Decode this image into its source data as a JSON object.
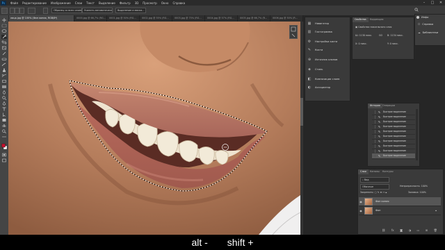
{
  "menubar": {
    "logo": "Ps",
    "items": [
      "Файл",
      "Редактирование",
      "Изображение",
      "Слои",
      "Текст",
      "Выделение",
      "Фильтр",
      "3D",
      "Просмотр",
      "Окно",
      "Справка"
    ],
    "window_controls": [
      "–",
      "□",
      "✕"
    ]
  },
  "options_bar": {
    "sample_all_layers": "Образец со всех слоев",
    "enhance_edge": "Усилить автоматически",
    "select_and_mask": "Выделение и маска..."
  },
  "document_tabs": {
    "active": "лицо.jpg @ 100% (Фон копия, RGB/8*)",
    "others": [
      "0000.jpg @ 66,7% (RG...",
      "0001.jpg @ 50% (RG...",
      "0002.jpg @ 55% (RG...",
      "0003.jpg @ 75% (RG...",
      "0004.jpg @ 57% (RG...",
      "0005.jpg @ 66,7% (R...",
      "0006.jpg @ 50% (R..."
    ]
  },
  "nav_panel": {
    "items": [
      {
        "label": "Навигатор",
        "icon": "navigator-icon"
      },
      {
        "label": "Гистограмма",
        "icon": "histogram-icon"
      },
      {
        "label": "Настройки кисти",
        "icon": "brush-settings-icon"
      },
      {
        "label": "Кисти",
        "icon": "brushes-icon"
      },
      {
        "label": "Источник клонов",
        "icon": "clone-source-icon"
      },
      {
        "label": "Стиль",
        "icon": "styles-icon"
      },
      {
        "label": "Композиции слоев",
        "icon": "layer-comps-icon"
      },
      {
        "label": "Ассоциатор",
        "icon": "adjust-icon"
      }
    ]
  },
  "properties": {
    "tabs": [
      "Свойства",
      "Коррекция"
    ],
    "title": "Свойства пиксельного слоя",
    "w_label": "Ш:",
    "w_value": "1130 пикс.",
    "h_label": "В:",
    "h_value": "1134 пикс.",
    "go_label": "GO",
    "x_label": "X:",
    "x_value": "0 пикс.",
    "y_label": "Y:",
    "y_value": "0 пикс."
  },
  "info_panel": {
    "tab": "Инфо",
    "learn": "Справка",
    "libraries": "Библиотеки"
  },
  "history": {
    "tabs": [
      "История",
      "Операции"
    ],
    "items": [
      "Быстрое выделение",
      "Быстрое выделение",
      "Быстрое выделение",
      "Быстрое выделение",
      "Быстрое выделение",
      "Быстрое выделение",
      "Быстрое выделение",
      "Быстрое выделение",
      "Быстрое выделение",
      "Быстрое выделение"
    ]
  },
  "layers": {
    "tabs": [
      "Слои",
      "Каналы",
      "Контуры"
    ],
    "filter_label": "Вид",
    "blend_mode": "Обычные",
    "opacity_label": "Непрозрачность:",
    "opacity_value": "100%",
    "lock_label": "Закрепить:",
    "fill_label": "Заливка:",
    "fill_value": "100%",
    "rows": [
      {
        "name": "Фон копия"
      },
      {
        "name": "Фон"
      }
    ]
  },
  "caption": {
    "left": "alt -",
    "right": "shift +"
  }
}
